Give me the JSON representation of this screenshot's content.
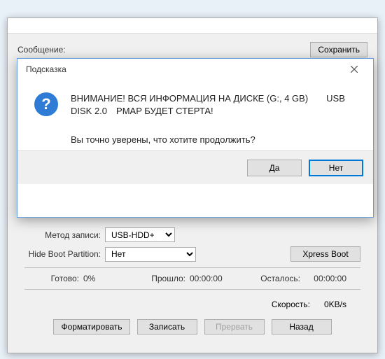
{
  "back": {
    "label_msg": "Сообщение:",
    "save_btn": "Сохранить"
  },
  "bottom": {
    "method_label": "Метод записи:",
    "method_value": "USB-HDD+",
    "hide_label": "Hide Boot Partition:",
    "hide_value": "Нет",
    "xpress_btn": "Xpress Boot",
    "ready_label": "Готово:",
    "ready_value": "0%",
    "elapsed_label": "Прошло:",
    "elapsed_value": "00:00:00",
    "remaining_label": "Осталось:",
    "remaining_value": "00:00:00",
    "speed_label": "Скорость:",
    "speed_value": "0KB/s",
    "format_btn": "Форматировать",
    "write_btn": "Записать",
    "abort_btn": "Прервать",
    "back_btn": "Назад"
  },
  "modal": {
    "title": "Подсказка",
    "warning": "ВНИМАНИЕ! ВСЯ ИНФОРМАЦИЯ НА ДИСКЕ (G:, 4 GB)  USB DISK 2.0 PMAP БУДЕТ СТЕРТА!",
    "confirm": "Вы точно уверены, что хотите продолжить?",
    "yes": "Да",
    "no": "Нет",
    "qmark": "?"
  }
}
